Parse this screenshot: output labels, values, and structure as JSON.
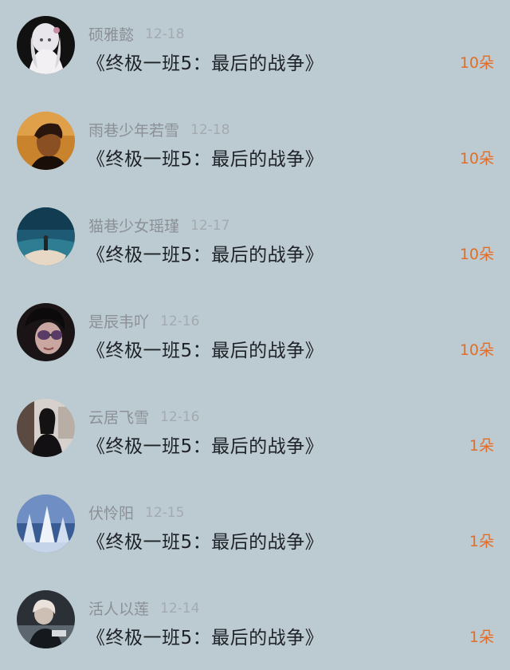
{
  "comments": [
    {
      "username": "硕雅懿",
      "date": "12-18",
      "title": "《终极一班5：最后的战争》",
      "count": "10朵",
      "avatar_icon": "avatar-girl-white-dress"
    },
    {
      "username": "雨巷少年若雪",
      "date": "12-18",
      "title": "《终极一班5：最后的战争》",
      "count": "10朵",
      "avatar_icon": "avatar-man-warm-tone"
    },
    {
      "username": "猫巷少女瑶瑾",
      "date": "12-17",
      "title": "《终极一班5：最后的战争》",
      "count": "10朵",
      "avatar_icon": "avatar-figure-sea-night"
    },
    {
      "username": "是辰韦吖",
      "date": "12-16",
      "title": "《终极一班5：最后的战争》",
      "count": "10朵",
      "avatar_icon": "avatar-man-sunglasses"
    },
    {
      "username": "云居飞雪",
      "date": "12-16",
      "title": "《终极一班5：最后的战争》",
      "count": "1朵",
      "avatar_icon": "avatar-woman-black-outfit"
    },
    {
      "username": "伏怜阳",
      "date": "12-15",
      "title": "《终极一班5：最后的战争》",
      "count": "1朵",
      "avatar_icon": "avatar-snowy-trees"
    },
    {
      "username": "活人以莲",
      "date": "12-14",
      "title": "《终极一班5：最后的战争》",
      "count": "1朵",
      "avatar_icon": "avatar-person-dark-scene"
    }
  ],
  "colors": {
    "background": "#bccbd2",
    "count_accent": "#e06e2a",
    "username": "#8a9095",
    "date": "#a3aab0",
    "title": "#1e2226"
  }
}
